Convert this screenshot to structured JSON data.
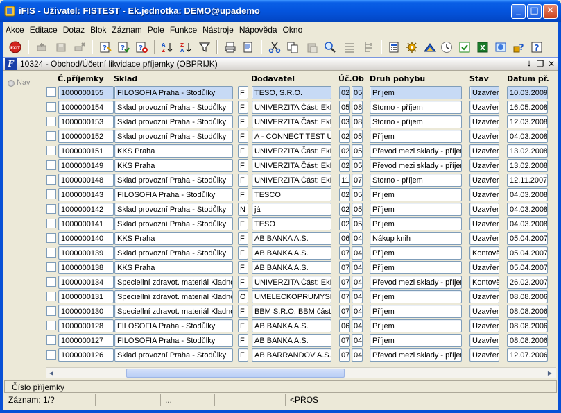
{
  "window": {
    "title": "iFIS - Uživatel: FISTEST - Ek.jednotka: DEMO@upademo",
    "buttons": {
      "minimize": "_",
      "maximize": "□",
      "close": "✕"
    }
  },
  "menu": [
    "Akce",
    "Editace",
    "Dotaz",
    "Blok",
    "Záznam",
    "Pole",
    "Funkce",
    "Nástroje",
    "Nápověda",
    "Okno"
  ],
  "toolbar": {
    "exit_label": "EXIT",
    "icons": [
      "exit-icon",
      "new-record-icon",
      "save-icon",
      "delete-icon",
      "enter-query-icon",
      "execute-query-icon",
      "cancel-query-icon",
      "sort-asc-icon",
      "sort-desc-icon",
      "filter-icon",
      "print-icon",
      "print-preview-icon",
      "cut-icon",
      "copy-icon",
      "paste-icon",
      "zoom-icon",
      "list-icon",
      "tree-icon",
      "calculator-icon",
      "settings-icon",
      "chart-icon",
      "clock-icon",
      "export-csv-icon",
      "export-excel-icon",
      "web-icon",
      "help-lock-icon",
      "help-icon"
    ]
  },
  "form": {
    "title": "10324 - Obchod/Účetní likvidace příjemky (OBPRIJK)",
    "icon_letter": "F",
    "nav_label": "Nav",
    "columns": {
      "cislo": "Č.příjemky",
      "sklad": "Sklad",
      "dodavatel": "Dodavatel",
      "ucob": "Úč.Ob",
      "druh": "Druh pohybu",
      "stav": "Stav",
      "datum": "Datum př."
    },
    "rows": [
      {
        "num": "1000000155",
        "sklad": "FILOSOFIA Praha - Stodůlky",
        "typ": "F",
        "dod": "TESO, S.R.O.",
        "uc": "02",
        "ob": "05",
        "druh": "Příjem",
        "stav": "Uzavřer",
        "datum": "10.03.2009"
      },
      {
        "num": "1000000154",
        "sklad": "Sklad provozní Praha - Stodůlky",
        "typ": "F",
        "dod": "UNIVERZITA Část: EkF",
        "uc": "05",
        "ob": "08",
        "druh": "Storno - příjem",
        "stav": "Uzavřer",
        "datum": "16.05.2008"
      },
      {
        "num": "1000000153",
        "sklad": "Sklad provozní Praha - Stodůlky",
        "typ": "F",
        "dod": "UNIVERZITA Část: EkF",
        "uc": "03",
        "ob": "08",
        "druh": "Storno - příjem",
        "stav": "Uzavřer",
        "datum": "12.03.2008"
      },
      {
        "num": "1000000152",
        "sklad": "Sklad provozní Praha - Stodůlky",
        "typ": "F",
        "dod": "A - CONNECT TEST UN",
        "uc": "02",
        "ob": "05",
        "druh": "Příjem",
        "stav": "Uzavřer",
        "datum": "04.03.2008"
      },
      {
        "num": "1000000151",
        "sklad": "KKS Praha",
        "typ": "F",
        "dod": "UNIVERZITA Část: EkF",
        "uc": "02",
        "ob": "05",
        "druh": "Převod mezi sklady - příjem",
        "stav": "Uzavřer",
        "datum": "13.02.2008"
      },
      {
        "num": "1000000149",
        "sklad": "KKS Praha",
        "typ": "F",
        "dod": "UNIVERZITA Část: EkF",
        "uc": "02",
        "ob": "05",
        "druh": "Převod mezi sklady - příjem",
        "stav": "Uzavřer",
        "datum": "13.02.2008"
      },
      {
        "num": "1000000148",
        "sklad": "Sklad provozní Praha - Stodůlky",
        "typ": "F",
        "dod": "UNIVERZITA Část: EkF",
        "uc": "11",
        "ob": "07",
        "druh": "Storno - příjem",
        "stav": "Uzavřer",
        "datum": "12.11.2007"
      },
      {
        "num": "1000000143",
        "sklad": "FILOSOFIA Praha - Stodůlky",
        "typ": "F",
        "dod": "TESCO",
        "uc": "02",
        "ob": "05",
        "druh": "Příjem",
        "stav": "Uzavřer",
        "datum": "04.03.2008"
      },
      {
        "num": "1000000142",
        "sklad": "Sklad provozní Praha - Stodůlky",
        "typ": "N",
        "dod": "já",
        "uc": "02",
        "ob": "05",
        "druh": "Příjem",
        "stav": "Uzavřer",
        "datum": "04.03.2008"
      },
      {
        "num": "1000000141",
        "sklad": "Sklad provozní Praha - Stodůlky",
        "typ": "F",
        "dod": " TESO",
        "uc": "02",
        "ob": "05",
        "druh": "Příjem",
        "stav": "Uzavřer",
        "datum": "04.03.2008"
      },
      {
        "num": "1000000140",
        "sklad": "KKS Praha",
        "typ": "F",
        "dod": "AB BANKA A.S.",
        "uc": "06",
        "ob": "04",
        "druh": "Nákup knih",
        "stav": "Uzavřer",
        "datum": "05.04.2007"
      },
      {
        "num": "1000000139",
        "sklad": "Sklad provozní Praha - Stodůlky",
        "typ": "F",
        "dod": "AB BANKA A.S.",
        "uc": "07",
        "ob": "04",
        "druh": "Příjem",
        "stav": "Kontově",
        "datum": "05.04.2007"
      },
      {
        "num": "1000000138",
        "sklad": "KKS Praha",
        "typ": "F",
        "dod": "AB BANKA A.S.",
        "uc": "07",
        "ob": "04",
        "druh": "Příjem",
        "stav": "Uzavřer",
        "datum": "05.04.2007"
      },
      {
        "num": "1000000134",
        "sklad": "Speciellní zdravot. materiál Kladno",
        "typ": "F",
        "dod": "UNIVERZITA Část: EkF",
        "uc": "07",
        "ob": "04",
        "druh": "Převod mezi sklady - příjem",
        "stav": "Kontově",
        "datum": "26.02.2007"
      },
      {
        "num": "1000000131",
        "sklad": "Speciellní zdravot. materiál Kladno",
        "typ": "O",
        "dod": "UMELECKOPRUMYSLC",
        "uc": "07",
        "ob": "04",
        "druh": "Příjem",
        "stav": "Uzavřer",
        "datum": "08.08.2006"
      },
      {
        "num": "1000000130",
        "sklad": "Speciellní zdravot. materiál Kladno",
        "typ": "F",
        "dod": "BBM S.R.O. BBM část",
        "uc": "07",
        "ob": "04",
        "druh": "Příjem",
        "stav": "Uzavřer",
        "datum": "08.08.2006"
      },
      {
        "num": "1000000128",
        "sklad": "FILOSOFIA Praha - Stodůlky",
        "typ": "F",
        "dod": "AB BANKA A.S.",
        "uc": "06",
        "ob": "04",
        "druh": "Příjem",
        "stav": "Uzavřer",
        "datum": "08.08.2006"
      },
      {
        "num": "1000000127",
        "sklad": "FILOSOFIA Praha - Stodůlky",
        "typ": "F",
        "dod": "AB BANKA A.S.",
        "uc": "07",
        "ob": "04",
        "druh": "Příjem",
        "stav": "Uzavřer",
        "datum": "08.08.2006"
      },
      {
        "num": "1000000126",
        "sklad": "Sklad provozní Praha - Stodůlky",
        "typ": "F",
        "dod": "AB BARRANDOV A.S.",
        "uc": "07",
        "ob": "04",
        "druh": "Převod mezi sklady - příjem",
        "stav": "Uzavřer",
        "datum": "12.07.2006"
      }
    ]
  },
  "hint": "Číslo příjemky",
  "status": {
    "record": "Záznam: 1/?",
    "seg2": "",
    "seg3": "...",
    "seg4": "",
    "mode": "<PŘOS"
  },
  "colors": {
    "titlebar": "#0454dd",
    "selected_row": "#c7daf5",
    "field_border": "#7f9db9"
  }
}
